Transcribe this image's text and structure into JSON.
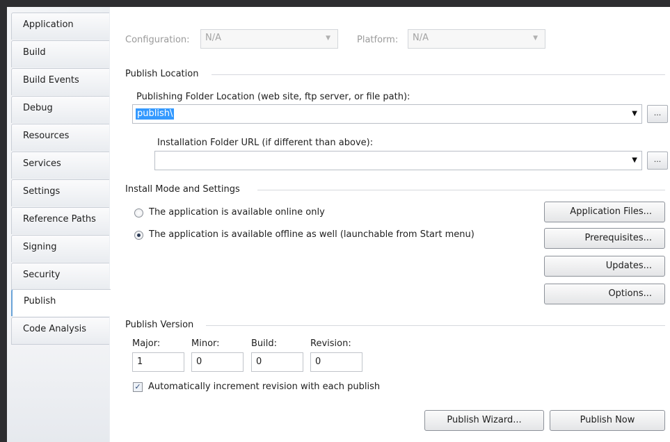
{
  "sidebar": {
    "tabs": [
      {
        "label": "Application"
      },
      {
        "label": "Build"
      },
      {
        "label": "Build Events"
      },
      {
        "label": "Debug"
      },
      {
        "label": "Resources"
      },
      {
        "label": "Services"
      },
      {
        "label": "Settings"
      },
      {
        "label": "Reference Paths"
      },
      {
        "label": "Signing"
      },
      {
        "label": "Security"
      },
      {
        "label": "Publish"
      },
      {
        "label": "Code Analysis"
      }
    ],
    "active": "Publish"
  },
  "config": {
    "configuration_label": "Configuration:",
    "configuration_value": "N/A",
    "platform_label": "Platform:",
    "platform_value": "N/A"
  },
  "publish_location": {
    "section_title": "Publish Location",
    "folder_label": "Publishing Folder Location (web site, ftp server, or file path):",
    "folder_value": "publish\\",
    "install_label": "Installation Folder URL (if different than above):",
    "install_value": "",
    "browse_label": "..."
  },
  "install_mode": {
    "section_title": "Install Mode and Settings",
    "option_online": "The application is available online only",
    "option_offline": "The application is available offline as well (launchable from Start menu)",
    "selected": "offline",
    "buttons": {
      "application_files": "Application Files...",
      "prerequisites": "Prerequisites...",
      "updates": "Updates...",
      "options": "Options..."
    }
  },
  "publish_version": {
    "section_title": "Publish Version",
    "major_label": "Major:",
    "minor_label": "Minor:",
    "build_label": "Build:",
    "revision_label": "Revision:",
    "major": "1",
    "minor": "0",
    "build": "0",
    "revision": "0",
    "auto_increment_label": "Automatically increment revision with each publish",
    "auto_increment_checked": true
  },
  "actions": {
    "wizard": "Publish Wizard...",
    "publish_now": "Publish Now"
  }
}
